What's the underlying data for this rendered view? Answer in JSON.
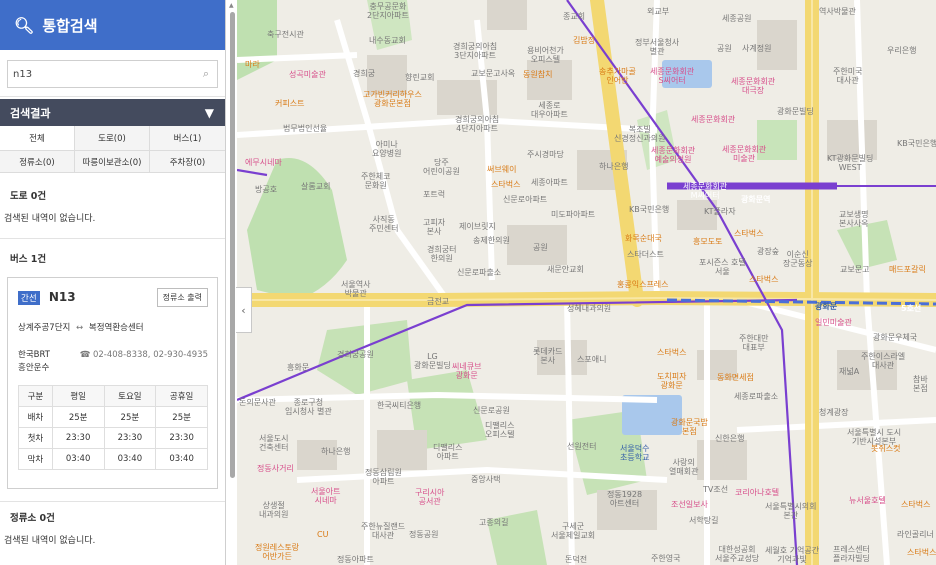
{
  "header": {
    "title": "통합검색"
  },
  "search": {
    "value": "n13"
  },
  "results": {
    "title": "검색결과",
    "tabs": [
      {
        "label": "전체",
        "active": true
      },
      {
        "label": "도로(0)"
      },
      {
        "label": "버스(1)"
      },
      {
        "label": "정류소(0)"
      },
      {
        "label": "따릉이보관소(0)"
      },
      {
        "label": "주차장(0)"
      }
    ]
  },
  "sections": {
    "road": {
      "title": "도로 0건",
      "empty": "검색된 내역이 없습니다."
    },
    "bus": {
      "title": "버스 1건"
    },
    "stop": {
      "title": "정류소 0건",
      "empty": "검색된 내역이 없습니다."
    }
  },
  "bus": {
    "badge": "간선",
    "number": "N13",
    "stop_button": "정류소 출력",
    "from": "상계주공7단지",
    "arrow": "↔",
    "to": "복정역환승센터",
    "company": "한국BRT\n흥안운수",
    "phone": "02-408-8338, 02-930-4935",
    "table": {
      "headers": [
        "구분",
        "평일",
        "토요일",
        "공휴일"
      ],
      "rows": [
        [
          "배차",
          "25분",
          "25분",
          "25분"
        ],
        [
          "첫차",
          "23:30",
          "23:30",
          "23:30"
        ],
        [
          "막차",
          "03:40",
          "03:40",
          "03:40"
        ]
      ]
    }
  },
  "map": {
    "colors": {
      "road_major": "#f3d872",
      "road": "#ffffff",
      "park": "#bfe0b0",
      "water": "#a9c8ec",
      "building": "#d9d5cc",
      "route": "#7a3fd0"
    },
    "labels": [
      {
        "text": "충무공문화\n2단지아파트",
        "cls": "gray"
      },
      {
        "text": "종교회",
        "cls": "gray"
      },
      {
        "text": "외교부",
        "cls": "gray"
      },
      {
        "text": "세종공원",
        "cls": "gray"
      },
      {
        "text": "역사박물관",
        "cls": "gray"
      },
      {
        "text": "축구전시관",
        "cls": "gray"
      },
      {
        "text": "내수동교회",
        "cls": "gray"
      },
      {
        "text": "경희궁의아침\n3단지아파트",
        "cls": "gray"
      },
      {
        "text": "용비어천가\n오피스텔",
        "cls": "gray"
      },
      {
        "text": "김밥정",
        "cls": "orange"
      },
      {
        "text": "정부서울청사\n별관",
        "cls": "gray"
      },
      {
        "text": "공원",
        "cls": "gray"
      },
      {
        "text": "사계정원",
        "cls": "gray"
      },
      {
        "text": "우리은행",
        "cls": "gray"
      },
      {
        "text": "마라",
        "cls": "orange"
      },
      {
        "text": "성곡미술관",
        "cls": "pink"
      },
      {
        "text": "경희궁",
        "cls": "gray"
      },
      {
        "text": "향린교회",
        "cls": "gray"
      },
      {
        "text": "교보문고사옥",
        "cls": "gray"
      },
      {
        "text": "동원참치",
        "cls": "orange"
      },
      {
        "text": "송추가마골\n인어반",
        "cls": "orange"
      },
      {
        "text": "세종문화회관\nS씨어터",
        "cls": "pink"
      },
      {
        "text": "세종문화회관\n대극장",
        "cls": "pink"
      },
      {
        "text": "주한미국\n대사관",
        "cls": "gray"
      },
      {
        "text": "커피스트",
        "cls": "orange"
      },
      {
        "text": "고가빈커리하우스\n광화문본점",
        "cls": "orange"
      },
      {
        "text": "세종로\n대우아파트",
        "cls": "gray"
      },
      {
        "text": "법무법인선율",
        "cls": "gray"
      },
      {
        "text": "경희궁의아침\n4단지아파트",
        "cls": "gray"
      },
      {
        "text": "광화문빌딩",
        "cls": "gray"
      },
      {
        "text": "세종문화회관",
        "cls": "pink"
      },
      {
        "text": "복조빌\n신경정신과의원",
        "cls": "gray"
      },
      {
        "text": "아미나\n요양병원",
        "cls": "gray"
      },
      {
        "text": "주시경마당",
        "cls": "gray"
      },
      {
        "text": "세종문화회관\n예술의정원",
        "cls": "pink"
      },
      {
        "text": "세종문화회관\n미술관",
        "cls": "pink"
      },
      {
        "text": "KT광화문빌딩\nWEST",
        "cls": "gray"
      },
      {
        "text": "KB국민은행",
        "cls": "gray"
      },
      {
        "text": "에무시네마",
        "cls": "pink"
      },
      {
        "text": "당주\n어린이공원",
        "cls": "gray"
      },
      {
        "text": "하나은행",
        "cls": "gray"
      },
      {
        "text": "써브웨이",
        "cls": "orange"
      },
      {
        "text": "방공호",
        "cls": "gray"
      },
      {
        "text": "살롬교회",
        "cls": "gray"
      },
      {
        "text": "주한체코\n문화원",
        "cls": "gray"
      },
      {
        "text": "스타벅스",
        "cls": "orange"
      },
      {
        "text": "세종아파트",
        "cls": "gray"
      },
      {
        "text": "세종문화회관\nM씨어터",
        "cls": "white"
      },
      {
        "text": "광화문역",
        "cls": "white"
      },
      {
        "text": "포트럭",
        "cls": "gray"
      },
      {
        "text": "신문로아파트",
        "cls": "gray"
      },
      {
        "text": "미도파아파트",
        "cls": "gray"
      },
      {
        "text": "KB국민은행",
        "cls": "gray"
      },
      {
        "text": "KT플라자",
        "cls": "gray"
      },
      {
        "text": "교보생명\n본사사옥",
        "cls": "gray"
      },
      {
        "text": "사직동\n주민센터",
        "cls": "gray"
      },
      {
        "text": "고피자\n본사",
        "cls": "gray"
      },
      {
        "text": "제이브릿지",
        "cls": "gray"
      },
      {
        "text": "송제한의원",
        "cls": "gray"
      },
      {
        "text": "화목순대국",
        "cls": "orange"
      },
      {
        "text": "흥모도토",
        "cls": "orange"
      },
      {
        "text": "스타벅스",
        "cls": "orange"
      },
      {
        "text": "광장숲",
        "cls": "gray"
      },
      {
        "text": "경희궁터\n한의원",
        "cls": "gray"
      },
      {
        "text": "공원",
        "cls": "gray"
      },
      {
        "text": "새문안교회",
        "cls": "gray"
      },
      {
        "text": "스타더스트",
        "cls": "gray"
      },
      {
        "text": "포시즌스 호텔\n서울",
        "cls": "gray"
      },
      {
        "text": "이순신\n장군동상",
        "cls": "gray"
      },
      {
        "text": "스타벅스",
        "cls": "orange"
      },
      {
        "text": "교보문고",
        "cls": "gray"
      },
      {
        "text": "매드포갈릭",
        "cls": "orange"
      },
      {
        "text": "신문로파출소",
        "cls": "gray"
      },
      {
        "text": "홍콩익스프레스",
        "cls": "orange"
      },
      {
        "text": "서울역사\n박물관",
        "cls": "gray"
      },
      {
        "text": "금전교",
        "cls": "gray"
      },
      {
        "text": "성혜내과의원",
        "cls": "gray"
      },
      {
        "text": "광화문",
        "cls": "blue"
      },
      {
        "text": "일민미술관",
        "cls": "pink"
      },
      {
        "text": "광화문우체국",
        "cls": "gray"
      },
      {
        "text": "주한대만\n대표부",
        "cls": "gray"
      },
      {
        "text": "경희궁공원",
        "cls": "gray"
      },
      {
        "text": "LG\n광화문빌딩",
        "cls": "gray"
      },
      {
        "text": "씨네큐브\n광화문",
        "cls": "pink"
      },
      {
        "text": "롯데카드\n본사",
        "cls": "gray"
      },
      {
        "text": "스포애니",
        "cls": "gray"
      },
      {
        "text": "스타벅스",
        "cls": "orange"
      },
      {
        "text": "주한이스라엘\n대사관",
        "cls": "gray"
      },
      {
        "text": "흥화문",
        "cls": "gray"
      },
      {
        "text": "도치피자\n광화문",
        "cls": "orange"
      },
      {
        "text": "동화면세점",
        "cls": "orange"
      },
      {
        "text": "재넓A",
        "cls": "gray"
      },
      {
        "text": "참바\n본점",
        "cls": "gray"
      },
      {
        "text": "돈의문사관",
        "cls": "gray"
      },
      {
        "text": "종로구청\n임시청사 별관",
        "cls": "gray"
      },
      {
        "text": "한국씨티은행",
        "cls": "gray"
      },
      {
        "text": "신문로공원",
        "cls": "gray"
      },
      {
        "text": "세종로파출소",
        "cls": "gray"
      },
      {
        "text": "청계광장",
        "cls": "gray"
      },
      {
        "text": "디팰리스\n오피스텔",
        "cls": "gray"
      },
      {
        "text": "광화문국밥\n본점",
        "cls": "orange"
      },
      {
        "text": "신한은행",
        "cls": "gray"
      },
      {
        "text": "서울특별시 도시\n기반시설본부",
        "cls": "gray"
      },
      {
        "text": "서울도시\n건축센터",
        "cls": "gray"
      },
      {
        "text": "하나은행",
        "cls": "gray"
      },
      {
        "text": "디팰리스\n아파트",
        "cls": "gray"
      },
      {
        "text": "선원전터",
        "cls": "gray"
      },
      {
        "text": "서울덕수\n초등학교",
        "cls": "blue"
      },
      {
        "text": "사랑의\n열매회관",
        "cls": "gray"
      },
      {
        "text": "봇쥐스컷",
        "cls": "orange"
      },
      {
        "text": "정동사거리",
        "cls": "pink"
      },
      {
        "text": "정동삼림원\n아파트",
        "cls": "gray"
      },
      {
        "text": "중앙사택",
        "cls": "gray"
      },
      {
        "text": "정동1928\n아트센터",
        "cls": "gray"
      },
      {
        "text": "TV조선",
        "cls": "gray"
      },
      {
        "text": "코리아나호텔",
        "cls": "pink"
      },
      {
        "text": "뉴서울호텔",
        "cls": "pink"
      },
      {
        "text": "스타벅스",
        "cls": "orange"
      },
      {
        "text": "서울아트\n시네마",
        "cls": "pink"
      },
      {
        "text": "구리시아\n공서관",
        "cls": "pink"
      },
      {
        "text": "조선일보사",
        "cls": "pink"
      },
      {
        "text": "서울특별시의회\n본관",
        "cls": "gray"
      },
      {
        "text": "상생절\n내과의원",
        "cls": "gray"
      },
      {
        "text": "CU",
        "cls": "orange"
      },
      {
        "text": "주한뉴질랜드\n대사관",
        "cls": "gray"
      },
      {
        "text": "고종의길",
        "cls": "gray"
      },
      {
        "text": "구세군\n서울제일교회",
        "cls": "gray"
      },
      {
        "text": "서학탕길",
        "cls": "gray"
      },
      {
        "text": "라인골리너",
        "cls": "gray"
      },
      {
        "text": "정원레스토랑\n어반가든",
        "cls": "orange"
      },
      {
        "text": "정동아파트",
        "cls": "gray"
      },
      {
        "text": "정동공원",
        "cls": "gray"
      },
      {
        "text": "돈덕전",
        "cls": "gray"
      },
      {
        "text": "주한영국",
        "cls": "gray"
      },
      {
        "text": "대한성공회\n서울주교성당",
        "cls": "gray"
      },
      {
        "text": "세월호 기억공간\n기억과빛",
        "cls": "gray"
      },
      {
        "text": "프레스센터\n플라자빌딩",
        "cls": "gray"
      },
      {
        "text": "스타벅스",
        "cls": "orange"
      },
      {
        "text": "5호선",
        "cls": "white"
      }
    ]
  }
}
